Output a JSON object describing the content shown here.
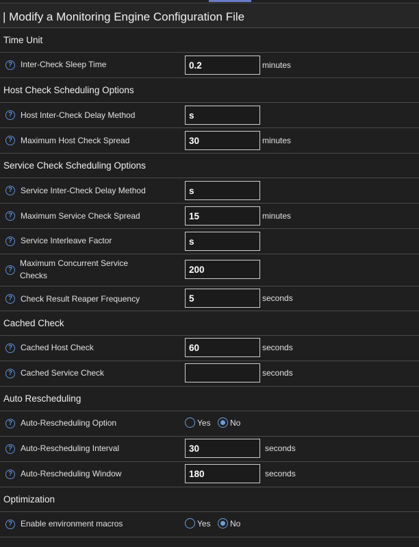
{
  "page_title": "| Modify a Monitoring Engine Configuration File",
  "sections": {
    "time_unit": "Time Unit",
    "host_check_scheduling": "Host Check Scheduling Options",
    "service_check_scheduling": "Service Check Scheduling Options",
    "cached_check": "Cached Check",
    "auto_rescheduling": "Auto Rescheduling",
    "optimization": "Optimization"
  },
  "fields": {
    "inter_check_sleep_time": {
      "label": "Inter-Check Sleep Time",
      "value": "0.2",
      "unit": "minutes"
    },
    "host_inter_check_delay_method": {
      "label": "Host Inter-Check Delay Method",
      "value": "s"
    },
    "max_host_check_spread": {
      "label": "Maximum Host Check Spread",
      "value": "30",
      "unit": "minutes"
    },
    "service_inter_check_delay_method": {
      "label": "Service Inter-Check Delay Method",
      "value": "s"
    },
    "max_service_check_spread": {
      "label": "Maximum Service Check Spread",
      "value": "15",
      "unit": "minutes"
    },
    "service_interleave_factor": {
      "label": "Service Interleave Factor",
      "value": "s"
    },
    "max_concurrent_service_checks": {
      "label_line1": "Maximum Concurrent Service",
      "label_line2": "Checks",
      "value": "200"
    },
    "check_result_reaper_frequency": {
      "label": "Check Result Reaper Frequency",
      "value": "5",
      "unit": "seconds"
    },
    "cached_host_check": {
      "label": "Cached Host Check",
      "value": "60",
      "unit": "seconds"
    },
    "cached_service_check": {
      "label": "Cached Service Check",
      "value": "",
      "unit": "seconds"
    },
    "auto_rescheduling_option": {
      "label": "Auto-Rescheduling Option",
      "yes": "Yes",
      "no": "No",
      "selected": "No"
    },
    "auto_rescheduling_interval": {
      "label": "Auto-Rescheduling Interval",
      "value": "30",
      "unit": "seconds"
    },
    "auto_rescheduling_window": {
      "label": "Auto-Rescheduling Window",
      "value": "180",
      "unit": "seconds"
    },
    "enable_environment_macros": {
      "label": "Enable environment macros",
      "yes": "Yes",
      "no": "No",
      "selected": "No"
    }
  },
  "icons": {
    "help": "help-circle-icon"
  },
  "colors": {
    "background": "#1f1f1f",
    "accent": "#5b8fd6",
    "border": "#4a4a4a"
  }
}
